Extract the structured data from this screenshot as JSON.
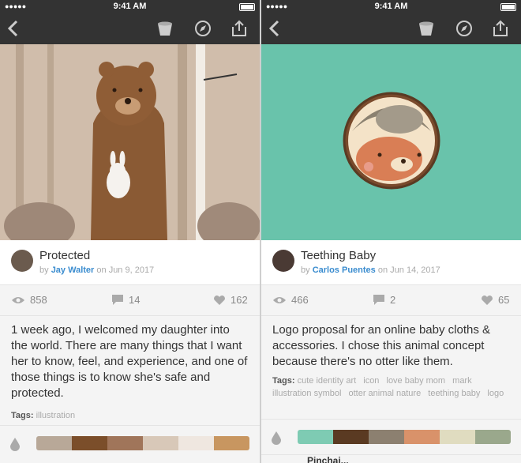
{
  "left": {
    "status": {
      "time": "9:41 AM",
      "signal": "●●●●●"
    },
    "shot": {
      "title": "Protected",
      "author": "Jay Walter",
      "date_prefix": "on",
      "date": "Jun 9, 2017",
      "by": "by"
    },
    "stats": {
      "views": "858",
      "comments": "14",
      "likes": "162"
    },
    "description": "1 week ago, I welcomed my daughter into the world. There are many things that I want her to know, feel, and experience, and one of those things is to know she's safe and protected.",
    "tags_label": "Tags:",
    "tags": [
      "illustration"
    ],
    "palette": [
      "#b8a898",
      "#7b4e2a",
      "#a0755a",
      "#d8c8b8",
      "#efe7e0",
      "#c89660"
    ]
  },
  "right": {
    "status": {
      "time": "9:41 AM",
      "signal": "●●●●●"
    },
    "shot": {
      "title": "Teething Baby",
      "author": "Carlos Puentes",
      "date_prefix": "on",
      "date": "Jun 14, 2017",
      "by": "by"
    },
    "stats": {
      "views": "466",
      "comments": "2",
      "likes": "65"
    },
    "description": "Logo proposal for an online baby cloths & accessories. I chose this animal concept because there's no otter like them.",
    "tags_label": "Tags:",
    "tags": [
      "cute identity art",
      "icon",
      "love baby mom",
      "mark",
      "illustration symbol",
      "otter animal nature",
      "teething baby",
      "logo"
    ],
    "palette": [
      "#7ecbb3",
      "#5a3a22",
      "#8c8070",
      "#d9926a",
      "#e0dcc0",
      "#9aa88c"
    ],
    "next_title": "Pinchai..."
  },
  "icons": {
    "back": "chevron-left-icon",
    "bucket": "bucket-icon",
    "compass": "compass-icon",
    "share": "share-icon",
    "eye": "eye-icon",
    "comment": "comment-icon",
    "heart": "heart-icon",
    "drop": "drop-icon"
  }
}
